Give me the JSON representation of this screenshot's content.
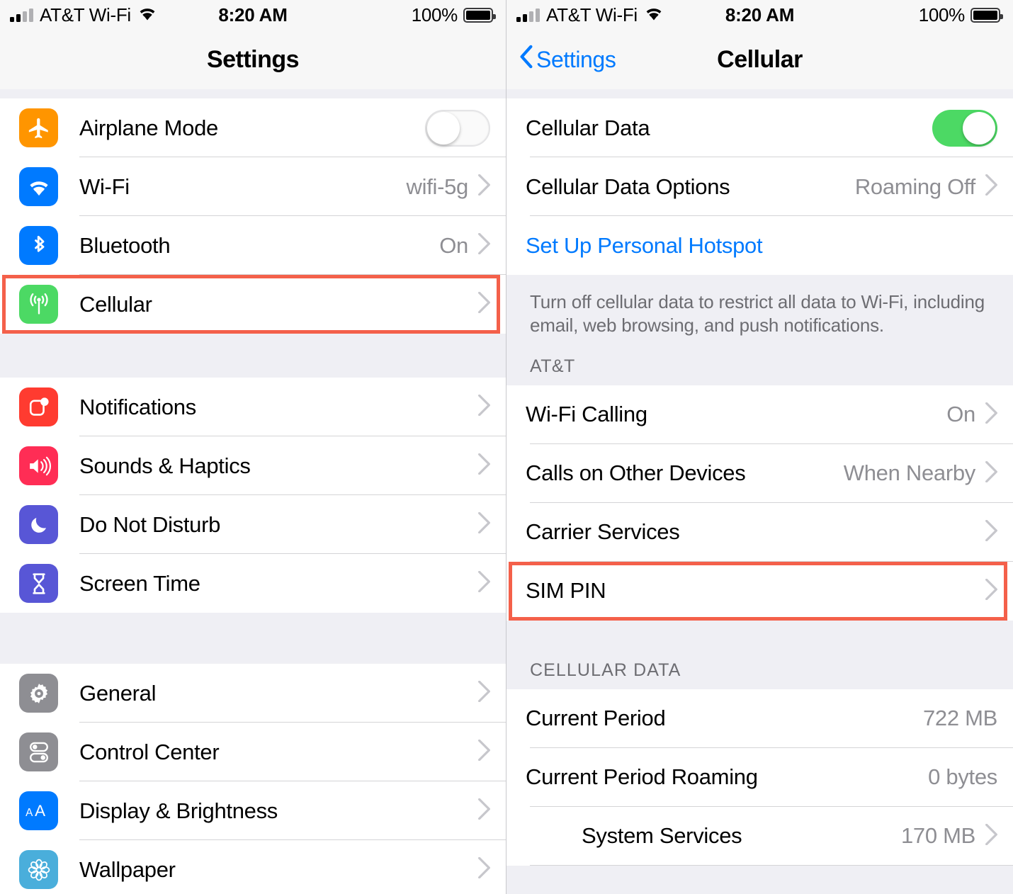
{
  "status_bar": {
    "carrier": "AT&T Wi-Fi",
    "time": "8:20 AM",
    "battery_percent": "100%",
    "signal_icon": "signal-bars-icon",
    "wifi_icon": "wifi-icon",
    "battery_icon": "battery-full-icon"
  },
  "left_screen": {
    "title": "Settings",
    "groups": [
      {
        "rows": [
          {
            "label": "Airplane Mode",
            "icon": "airplane-icon",
            "icon_color": "#FF9500",
            "control": "toggle",
            "toggle_on": false
          },
          {
            "label": "Wi-Fi",
            "icon": "wifi-icon",
            "icon_color": "#007AFF",
            "value": "wifi-5g",
            "control": "chevron"
          },
          {
            "label": "Bluetooth",
            "icon": "bluetooth-icon",
            "icon_color": "#007AFF",
            "value": "On",
            "control": "chevron"
          },
          {
            "label": "Cellular",
            "icon": "cellular-antenna-icon",
            "icon_color": "#4CD964",
            "value": "",
            "control": "chevron",
            "highlighted": true
          }
        ]
      },
      {
        "rows": [
          {
            "label": "Notifications",
            "icon": "notifications-icon",
            "icon_color": "#FF3B30",
            "value": "",
            "control": "chevron"
          },
          {
            "label": "Sounds & Haptics",
            "icon": "speaker-icon",
            "icon_color": "#FF2D55",
            "value": "",
            "control": "chevron"
          },
          {
            "label": "Do Not Disturb",
            "icon": "moon-icon",
            "icon_color": "#5856D6",
            "value": "",
            "control": "chevron"
          },
          {
            "label": "Screen Time",
            "icon": "hourglass-icon",
            "icon_color": "#5856D6",
            "value": "",
            "control": "chevron"
          }
        ]
      },
      {
        "rows": [
          {
            "label": "General",
            "icon": "gear-icon",
            "icon_color": "#8E8E93",
            "value": "",
            "control": "chevron"
          },
          {
            "label": "Control Center",
            "icon": "control-center-icon",
            "icon_color": "#8E8E93",
            "value": "",
            "control": "chevron"
          },
          {
            "label": "Display & Brightness",
            "icon": "display-brightness-icon",
            "icon_color": "#007AFF",
            "value": "",
            "control": "chevron"
          },
          {
            "label": "Wallpaper",
            "icon": "wallpaper-flower-icon",
            "icon_color": "#4AAEDB",
            "value": "",
            "control": "chevron"
          }
        ]
      }
    ]
  },
  "right_screen": {
    "back_label": "Settings",
    "title": "Cellular",
    "group1": [
      {
        "label": "Cellular Data",
        "control": "toggle",
        "toggle_on": true
      },
      {
        "label": "Cellular Data Options",
        "value": "Roaming Off",
        "control": "chevron"
      },
      {
        "label": "Set Up Personal Hotspot",
        "style": "link",
        "control": "none"
      }
    ],
    "footer_text": "Turn off cellular data to restrict all data to Wi-Fi, including email, web browsing, and push notifications.",
    "carrier_section_header": "AT&T",
    "group2": [
      {
        "label": "Wi-Fi Calling",
        "value": "On",
        "control": "chevron"
      },
      {
        "label": "Calls on Other Devices",
        "value": "When Nearby",
        "control": "chevron"
      },
      {
        "label": "Carrier Services",
        "value": "",
        "control": "chevron"
      },
      {
        "label": "SIM PIN",
        "value": "",
        "control": "chevron",
        "highlighted": true
      }
    ],
    "data_section_header": "CELLULAR DATA",
    "group3": [
      {
        "label": "Current Period",
        "value": "722 MB",
        "control": "none"
      },
      {
        "label": "Current Period Roaming",
        "value": "0 bytes",
        "control": "none"
      },
      {
        "label": "System Services",
        "value": "170 MB",
        "control": "chevron",
        "indent": true
      }
    ]
  },
  "colors": {
    "accent_blue": "#007AFF",
    "toggle_on_green": "#4CD964",
    "highlight_red": "#F4604A",
    "group_background": "#EFEFF4",
    "secondary_text": "#8E8E93"
  }
}
